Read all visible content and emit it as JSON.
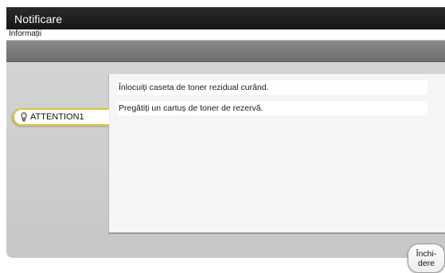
{
  "header": {
    "title": "Notificare",
    "subtitle": "Informații"
  },
  "tabs": [
    {
      "label": "ATTENTION1",
      "icon": "lightbulb-icon",
      "selected": true
    }
  ],
  "messages": [
    "Înlocuiți caseta de toner rezidual curând.",
    "Pregătiți un cartuș de toner de rezervă."
  ],
  "close_button": {
    "line1": "Închi-",
    "line2": "dere"
  },
  "colors": {
    "tab_accent": "#e4c52b",
    "title_bar": "#1f1f1f"
  }
}
